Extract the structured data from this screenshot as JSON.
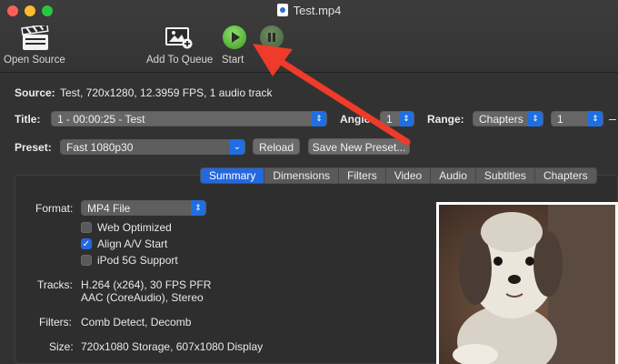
{
  "window": {
    "title": "Test.mp4"
  },
  "toolbar": {
    "open_source": "Open Source",
    "add_to_queue": "Add To Queue",
    "start": "Start"
  },
  "source": {
    "label": "Source:",
    "value": "Test, 720x1280, 12.3959 FPS, 1 audio track"
  },
  "title_row": {
    "label": "Title:",
    "value": "1 - 00:00:25 - Test",
    "angle_label": "Angle:",
    "angle_value": "1",
    "range_label": "Range:",
    "range_type": "Chapters",
    "range_start": "1"
  },
  "preset_row": {
    "label": "Preset:",
    "value": "Fast 1080p30",
    "reload": "Reload",
    "save_new": "Save New Preset..."
  },
  "tabs": [
    {
      "label": "Summary",
      "active": true
    },
    {
      "label": "Dimensions"
    },
    {
      "label": "Filters"
    },
    {
      "label": "Video"
    },
    {
      "label": "Audio"
    },
    {
      "label": "Subtitles"
    },
    {
      "label": "Chapters"
    }
  ],
  "summary": {
    "format_label": "Format:",
    "format_value": "MP4 File",
    "web_optimized": {
      "label": "Web Optimized",
      "checked": false
    },
    "align_av": {
      "label": "Align A/V Start",
      "checked": true
    },
    "ipod": {
      "label": "iPod 5G Support",
      "checked": false
    },
    "tracks_label": "Tracks:",
    "tracks_line1": "H.264 (x264), 30 FPS PFR",
    "tracks_line2": "AAC (CoreAudio), Stereo",
    "filters_label": "Filters:",
    "filters_value": "Comb Detect, Decomb",
    "size_label": "Size:",
    "size_value": "720x1080 Storage, 607x1080 Display"
  },
  "colors": {
    "accent": "#2468e0",
    "annotation_arrow": "#f03a2a",
    "start_green": "#5fb43a"
  },
  "icons": [
    "clapperboard-icon",
    "add-queue-icon",
    "play-icon",
    "pause-icon",
    "document-icon"
  ]
}
